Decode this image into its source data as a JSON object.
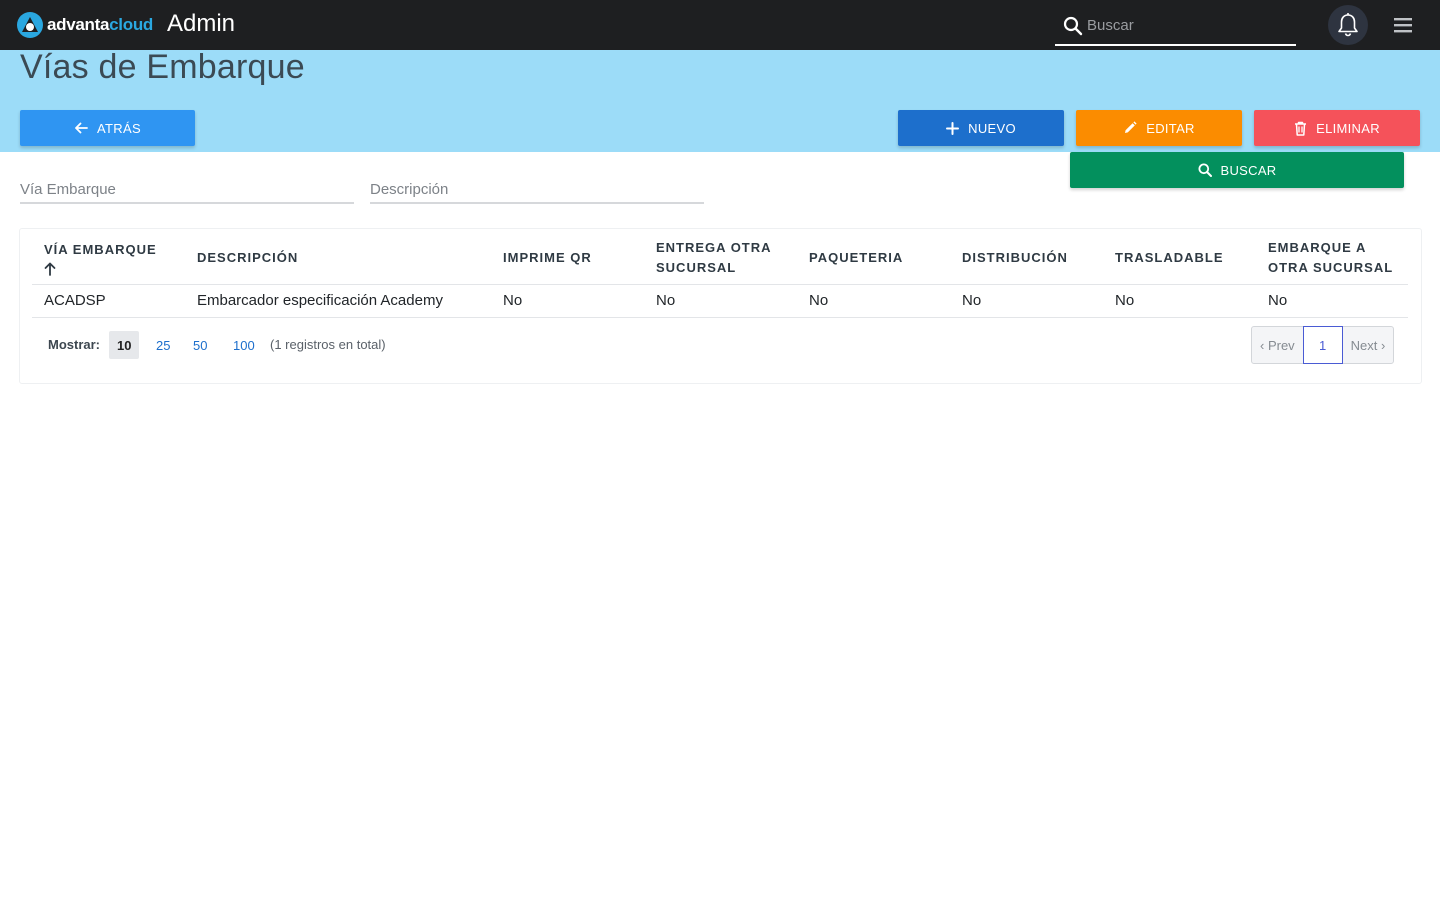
{
  "colors": {
    "topbar": "#1e1f21",
    "band": "#9cdcf8",
    "back": "#2f95f2",
    "new": "#1d6fcc",
    "edit": "#fb8c00",
    "delete": "#f5525a",
    "search": "#03905d"
  },
  "header": {
    "logo_main": "advanta",
    "logo_accent": "cloud",
    "app_title": "Admin",
    "search_placeholder": "Buscar",
    "icons": [
      "search-icon",
      "bell-icon",
      "hamburger-menu-icon"
    ]
  },
  "page": {
    "title": "Vías de Embarque"
  },
  "actions": {
    "back": "ATRÁS",
    "new": "NUEVO",
    "edit": "EDITAR",
    "delete": "ELIMINAR",
    "search": "BUSCAR"
  },
  "filters": {
    "via_placeholder": "Vía Embarque",
    "desc_placeholder": "Descripción"
  },
  "table": {
    "columns": [
      "VÍA EMBARQUE",
      "DESCRIPCIÓN",
      "IMPRIME QR",
      "ENTREGA OTRA SUCURSAL",
      "PAQUETERIA",
      "DISTRIBUCIÓN",
      "TRASLADABLE",
      "EMBARQUE A OTRA SUCURSAL"
    ],
    "rows": [
      [
        "ACADSP",
        "Embarcador especificación Academy",
        "No",
        "No",
        "No",
        "No",
        "No",
        "No"
      ]
    ]
  },
  "pagination": {
    "show_label": "Mostrar:",
    "sizes": [
      "10",
      "25",
      "50",
      "100"
    ],
    "active_size": "10",
    "total_text": "(1 registros en total)",
    "prev": "‹ Prev",
    "current": "1",
    "next": "Next ›"
  }
}
